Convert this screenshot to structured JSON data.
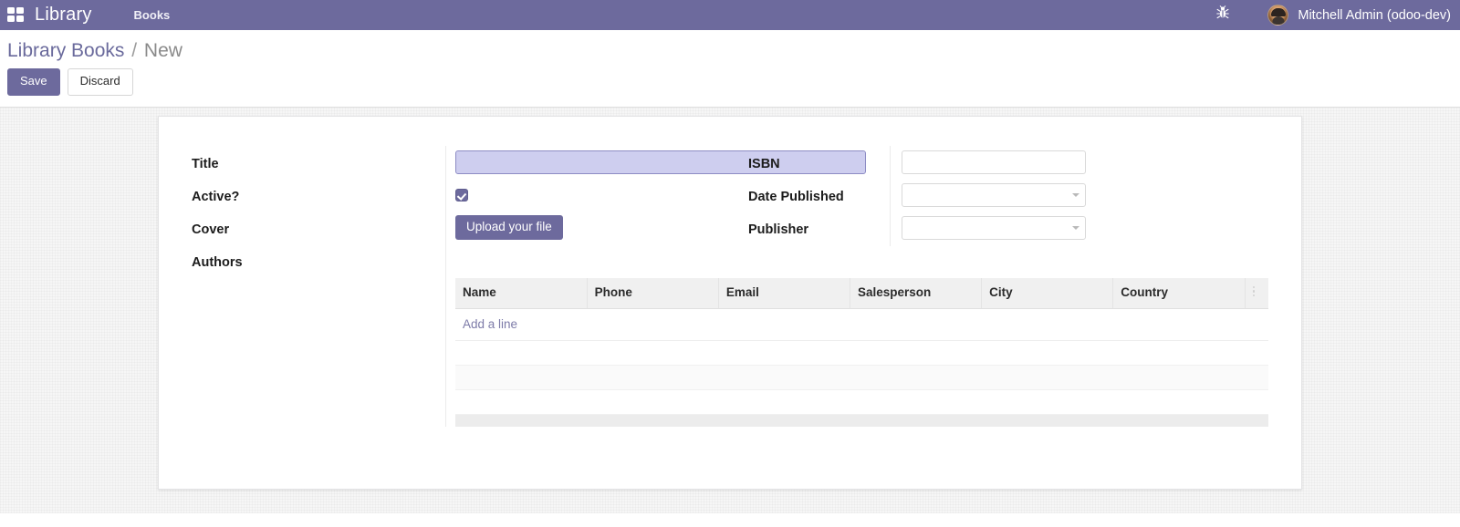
{
  "navbar": {
    "apps_icon": "apps-grid-icon",
    "brand": "Library",
    "menu_items": [
      {
        "label": "Books"
      }
    ],
    "debug_icon": "bug-icon",
    "user_name": "Mitchell Admin (odoo-dev)",
    "background_color": "#6d6a9d"
  },
  "control_panel": {
    "breadcrumb": {
      "root": "Library Books",
      "separator": "/",
      "current": "New"
    },
    "buttons": {
      "save": "Save",
      "discard": "Discard"
    }
  },
  "form": {
    "left_group": {
      "labels": [
        {
          "label": "Title"
        },
        {
          "label": "Active?"
        },
        {
          "label": "Cover"
        },
        {
          "label": "Authors"
        }
      ],
      "title": {
        "value": "",
        "placeholder": "",
        "focused": true
      },
      "active": {
        "checked": true
      },
      "cover": {
        "upload_label": "Upload your file"
      }
    },
    "right_group": {
      "labels": [
        {
          "label": "ISBN"
        },
        {
          "label": "Date Published"
        },
        {
          "label": "Publisher"
        }
      ],
      "isbn": {
        "value": "",
        "placeholder": ""
      },
      "date_published": {
        "value": "",
        "placeholder": "",
        "caret": "caret-down-icon"
      },
      "publisher": {
        "value": "",
        "placeholder": "",
        "caret": "caret-down-icon"
      }
    },
    "authors_table": {
      "columns": [
        {
          "label": "Name"
        },
        {
          "label": "Phone"
        },
        {
          "label": "Email"
        },
        {
          "label": "Salesperson"
        },
        {
          "label": "City"
        },
        {
          "label": "Country"
        }
      ],
      "options_icon": "vertical-dots-icon",
      "add_line_label": "Add a line",
      "rows": []
    }
  },
  "colors": {
    "brand_purple": "#6d6a9d",
    "focused_input_bg": "#ceceef",
    "focused_input_border": "#8d8cc4",
    "link_purple": "#7d7ba8",
    "sheet_bg": "#ffffff",
    "page_bg": "#f6f6f6"
  }
}
